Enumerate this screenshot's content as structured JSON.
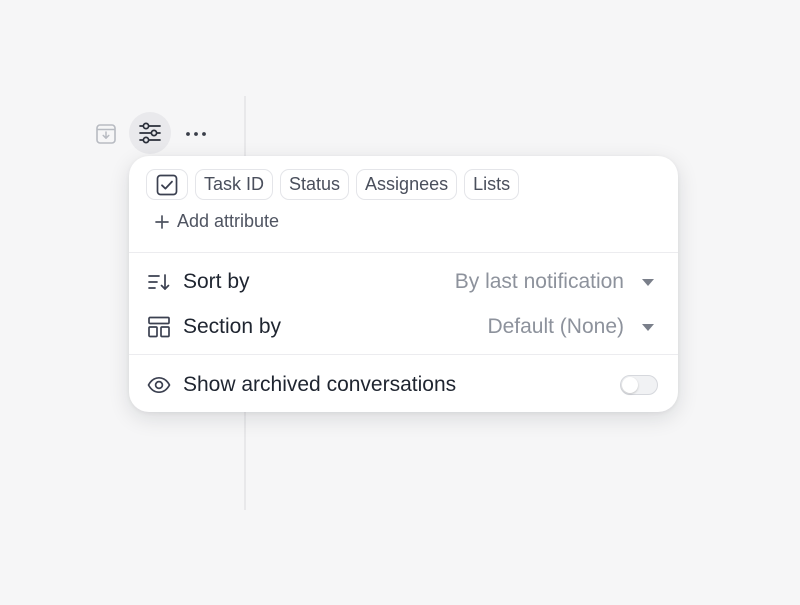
{
  "toolbar": {
    "archive_icon": "archive-download-icon",
    "filter_icon": "sliders-icon",
    "more_icon": "more-horizontal-icon"
  },
  "popover": {
    "attributes": {
      "checkbox_icon": "checkbox-icon",
      "chips": [
        "Task ID",
        "Status",
        "Assignees",
        "Lists"
      ],
      "add_label": "Add attribute"
    },
    "sort": {
      "label": "Sort by",
      "value": "By last notification"
    },
    "section": {
      "label": "Section by",
      "value": "Default (None)"
    },
    "archived": {
      "label": "Show archived conversations",
      "enabled": false
    }
  },
  "colors": {
    "background": "#f6f6f7",
    "panel": "#ffffff",
    "text": "#1f2530",
    "muted": "#8d929c"
  }
}
